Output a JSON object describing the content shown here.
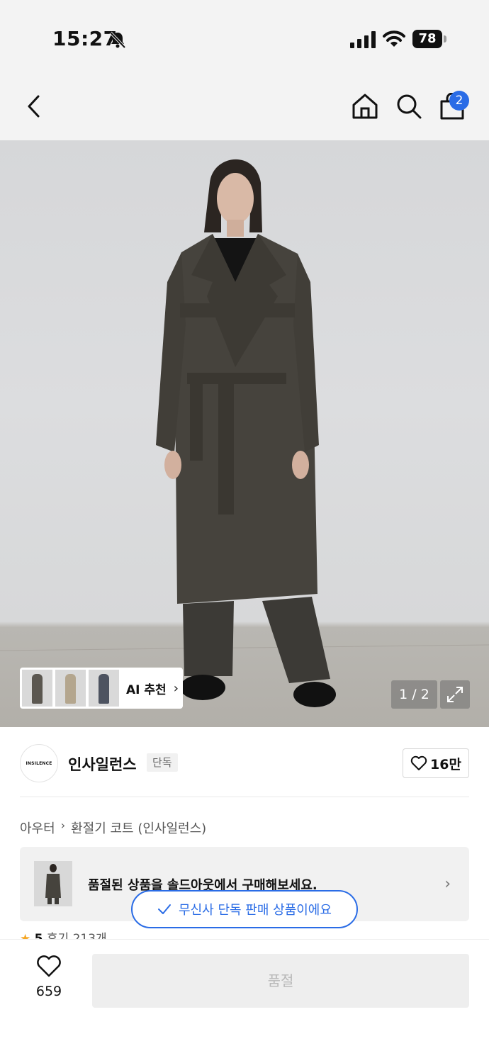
{
  "status_bar": {
    "time": "15:27",
    "battery": "78"
  },
  "header": {
    "cart_count": "2"
  },
  "gallery": {
    "ai_label": "AI 추천",
    "page_indicator": "1 / 2"
  },
  "brand": {
    "logo_text": "INSILENCE",
    "name": "인사일런스",
    "tag": "단독",
    "likes": "16만"
  },
  "breadcrumb": {
    "category": "아우터",
    "product": "환절기 코트 (인사일런스)"
  },
  "soldout_banner": {
    "text": "품절된 상품을 솔드아웃에서 구매해보세요."
  },
  "toast": {
    "text": "무신사 단독 판매 상품이에요"
  },
  "reviews": {
    "score": "5",
    "text": "후기 213개"
  },
  "bottom": {
    "wish_count": "659",
    "buy_label": "품절"
  },
  "colors": {
    "accent": "#2a6ce6",
    "star": "#f5a623",
    "coat": "#46433d"
  }
}
